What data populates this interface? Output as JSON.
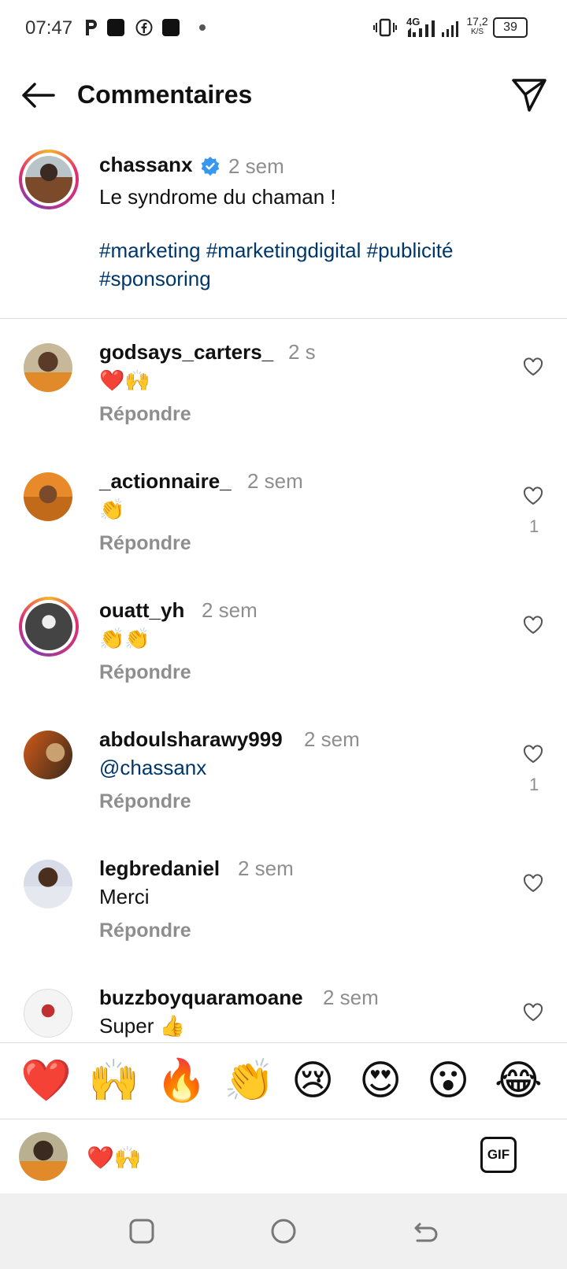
{
  "status_bar": {
    "time": "07:47",
    "network": "4G",
    "speed_top": "17,2",
    "speed_bottom": "K/S",
    "battery": "39"
  },
  "header": {
    "title": "Commentaires",
    "back_icon": "arrow-left-icon",
    "send_icon": "paper-plane-icon"
  },
  "caption": {
    "username": "chassanx",
    "time": "2 sem",
    "text": "Le syndrome du chaman !",
    "hashtags": "#marketing #marketingdigital #publicité #sponsoring"
  },
  "comments": [
    {
      "username": "godsays_carters_",
      "time": "2 s",
      "text": "❤️🙌",
      "reply": "Répondre",
      "likes": ""
    },
    {
      "username": "_actionnaire_",
      "time": "2 sem",
      "text": "👏",
      "reply": "Répondre",
      "likes": "1"
    },
    {
      "username": "ouatt_yh",
      "time": "2 sem",
      "text": "👏👏",
      "reply": "Répondre",
      "likes": ""
    },
    {
      "username": "abdoulsharawy999",
      "time": "2 sem",
      "text": "@chassanx",
      "reply": "Répondre",
      "likes": "1"
    },
    {
      "username": "legbredaniel",
      "time": "2 sem",
      "text": "Merci",
      "reply": "Répondre",
      "likes": ""
    },
    {
      "username": "buzzboyquaramoane",
      "time": "2 sem",
      "text": "Super 👍",
      "reply": "",
      "likes": ""
    }
  ],
  "emoji_bar": [
    "❤️",
    "🙌",
    "🔥",
    "👏",
    "😢",
    "😍",
    "😮",
    "😂"
  ],
  "input": {
    "value": "❤️🙌",
    "gif_label": "GIF"
  },
  "colors": {
    "hashtag": "#00376b",
    "muted": "#8e8e8e",
    "verified": "#3897f0"
  }
}
